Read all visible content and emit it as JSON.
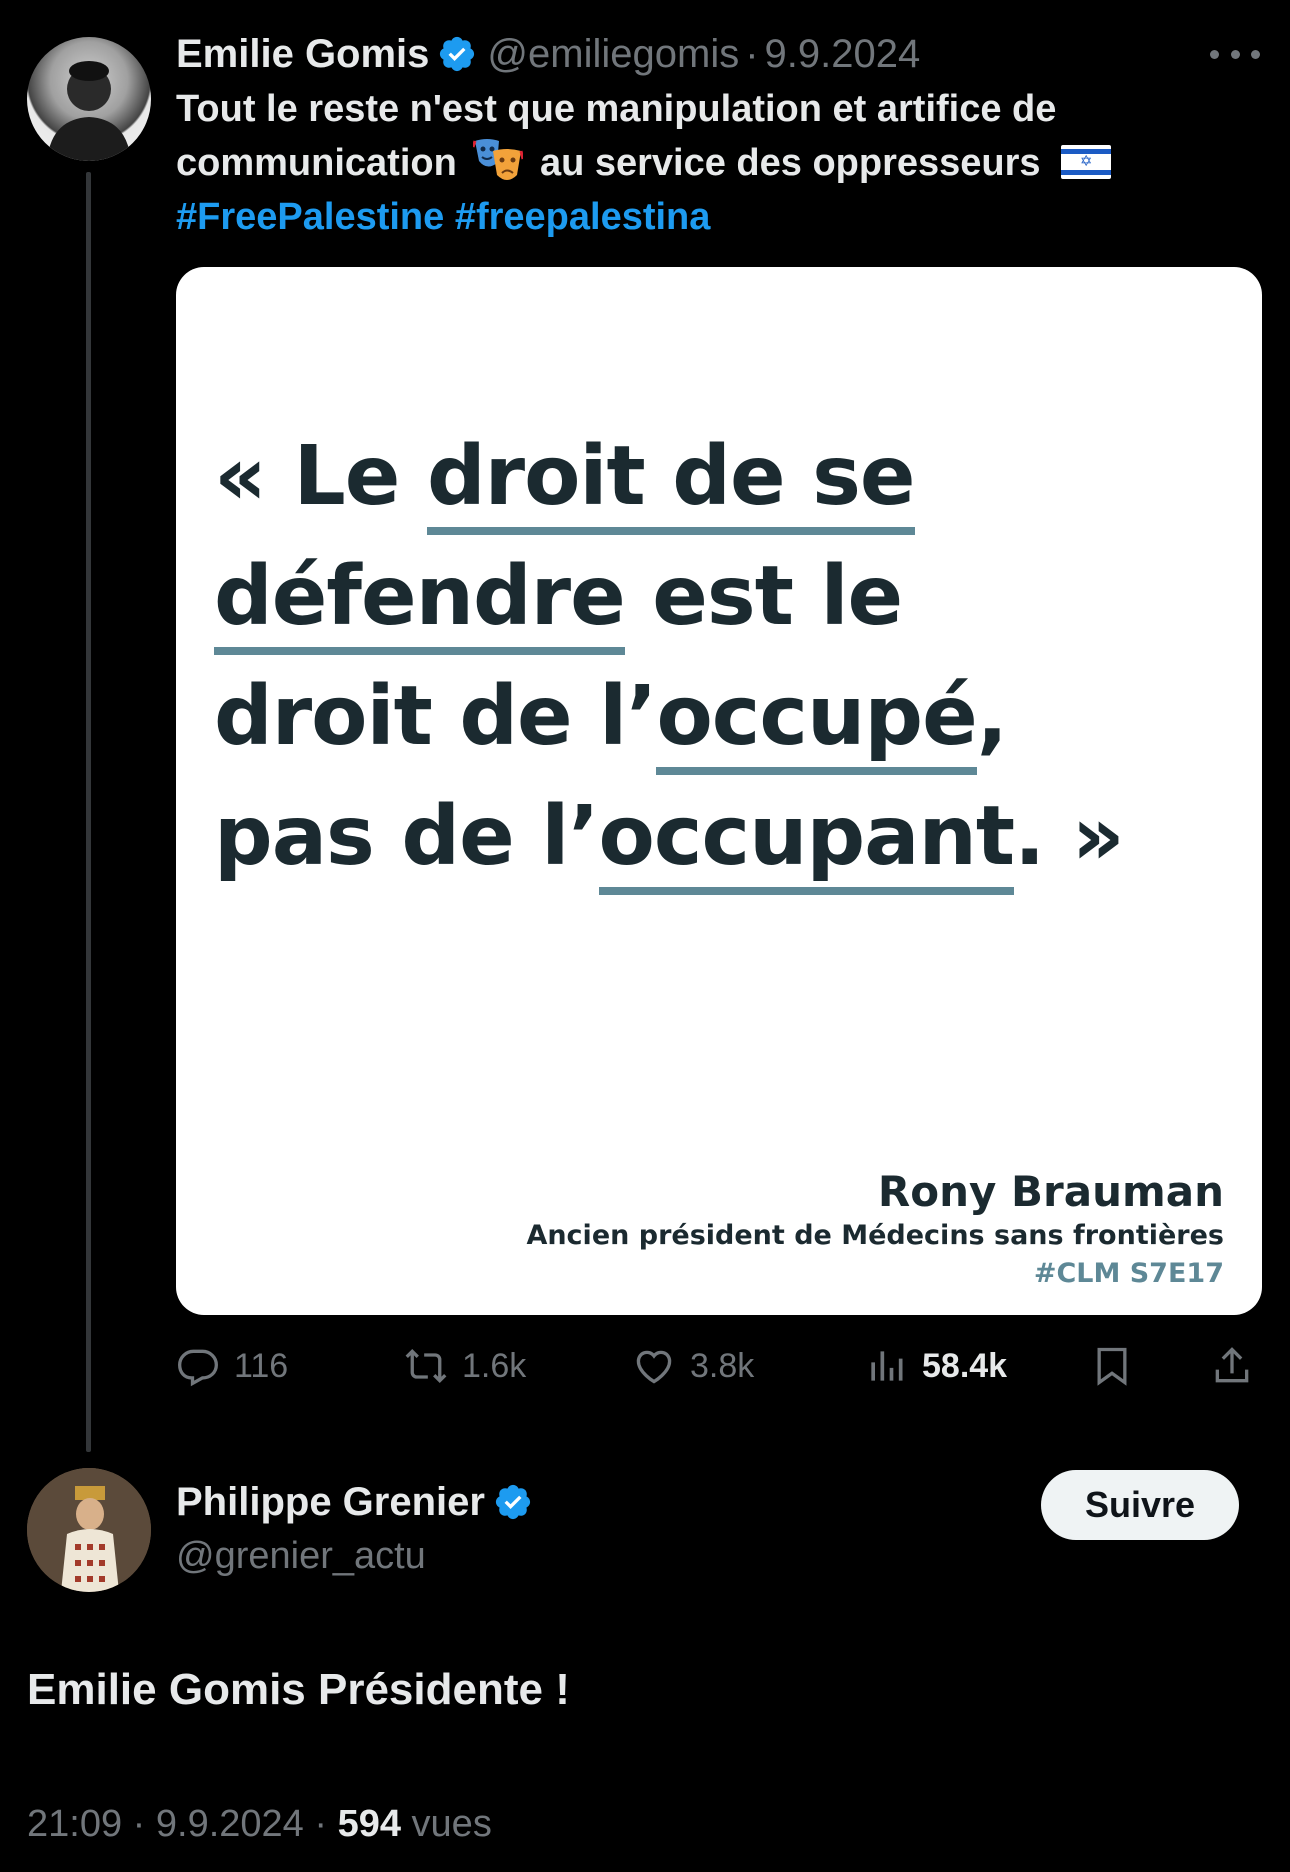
{
  "original_tweet": {
    "author_name": "Emilie Gomis",
    "handle": "@emiliegomis",
    "separator": "·",
    "date": "9.9.2024",
    "text_line_1": "Tout le reste n'est que manipulation et artifice de",
    "text_line_2a": "communication",
    "text_line_2b": "au service des oppresseurs",
    "hashtags": [
      "#FreePalestine",
      "#freepalestina"
    ],
    "image": {
      "quote_lines": [
        [
          "« Le ",
          "droit de se",
          ""
        ],
        [
          "",
          "défendre",
          " est le"
        ],
        [
          "droit de l’",
          "occupé",
          ","
        ],
        [
          "pas de l’",
          "occupant",
          ". »"
        ]
      ],
      "attribution_name": "Rony Brauman",
      "attribution_role": "Ancien président de Médecins sans frontières",
      "attribution_tag": "#CLM S7E17"
    },
    "actions": {
      "replies": "116",
      "retweets": "1.6k",
      "likes": "3.8k",
      "views": "58.4k"
    }
  },
  "reply": {
    "author_name": "Philippe Grenier",
    "handle": "@grenier_actu",
    "follow_label": "Suivre",
    "text": "Emilie Gomis Présidente !",
    "time": "21:09",
    "separator": "·",
    "date": "9.9.2024",
    "views_count": "594",
    "views_label": "vues"
  },
  "colors": {
    "background": "#000000",
    "text": "#e7e9ea",
    "muted": "#71767b",
    "link": "#1d9bf0",
    "verified": "#1d9bf0",
    "quote_text": "#1b2a30",
    "quote_underline": "#5e8896"
  },
  "icons": [
    "verified-badge-icon",
    "more-icon",
    "reply-icon",
    "retweet-icon",
    "like-icon",
    "views-icon",
    "bookmark-icon",
    "share-icon",
    "theater-masks-emoji",
    "israel-flag-emoji"
  ]
}
